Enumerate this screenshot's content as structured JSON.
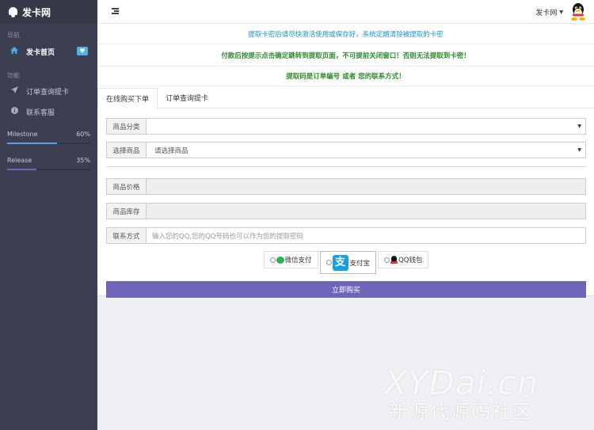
{
  "sidebar": {
    "brand": "发卡网",
    "nav_section": "导航",
    "home_label": "发卡首页",
    "home_badge": "♥",
    "func_section": "功能",
    "items": [
      {
        "label": "订单查询提卡",
        "icon": "send-icon"
      },
      {
        "label": "联系客服",
        "icon": "info-icon"
      }
    ],
    "progress": [
      {
        "label": "Milestone",
        "percent": "60%",
        "value": 60,
        "color": "#4ea6e8"
      },
      {
        "label": "Release",
        "percent": "35%",
        "value": 35,
        "color": "#6f65b8"
      }
    ]
  },
  "topbar": {
    "user_name": "发卡网",
    "caret": "▼"
  },
  "notices": [
    "提取卡密后请尽快激活使用或保存好，系统定期清除被提取的卡密",
    "付款后按提示点击确定跳转到提取页面，不可提前关闭窗口！否则无法提取到卡密！",
    "提取码是订单编号 或者 您的联系方式！"
  ],
  "tabs": [
    "在线购买下单",
    "订单查询提卡"
  ],
  "form": {
    "category_label": "商品分类",
    "category_value": "",
    "product_label": "选择商品",
    "product_value": "请选择商品",
    "price_label": "商品价格",
    "price_value": "",
    "stock_label": "商品库存",
    "stock_value": "",
    "contact_label": "联系方式",
    "contact_placeholder": "输入您的QQ,您的QQ号码也可以作为您的提取密码"
  },
  "payments": [
    {
      "label": "微信支付",
      "icon": "wechat-icon"
    },
    {
      "label": "支付宝",
      "icon": "alipay-icon",
      "selected": true
    },
    {
      "label": "QQ钱包",
      "icon": "qq-icon"
    }
  ],
  "buy_button": "立即购买",
  "watermark": {
    "line1": "XYDai.cn",
    "line2": "新源代源码社区"
  },
  "colors": {
    "sidebar_bg": "#3b3f51",
    "notice_blue": "#1a95d4",
    "notice_green": "#2c8b2c",
    "buy_button": "#6f65b8"
  }
}
